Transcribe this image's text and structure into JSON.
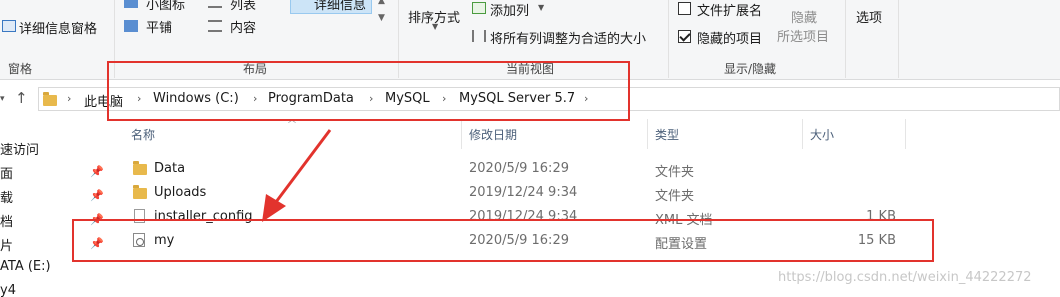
{
  "ribbon": {
    "pane_group": {
      "details_pane": "详细信息窗格",
      "label": "窗格"
    },
    "layout_group": {
      "small_icons": "小图标",
      "list": "列表",
      "details": "详细信息",
      "tiles": "平铺",
      "content": "内容",
      "label": "布局"
    },
    "current_view_group": {
      "sort_by": "排序方式",
      "add_columns": "添加列",
      "size_all_columns": "将所有列调整为合适的大小",
      "label": "当前视图"
    },
    "show_hide_group": {
      "file_extensions": "文件扩展名",
      "file_extensions_checked": false,
      "hidden_items": "隐藏的项目",
      "hidden_items_checked": true,
      "hide_selected_line1": "隐藏",
      "hide_selected_line2": "所选项目",
      "label": "显示/隐藏"
    },
    "options": "选项"
  },
  "address_bar": {
    "breadcrumbs": [
      "此电脑",
      "Windows (C:)",
      "ProgramData",
      "MySQL",
      "MySQL Server 5.7"
    ]
  },
  "columns": {
    "name": "名称",
    "date_modified": "修改日期",
    "type": "类型",
    "size": "大小"
  },
  "nav_pane": {
    "items": [
      "速访问",
      "面",
      "载",
      "档",
      "片",
      "ATA (E:)",
      "y4"
    ]
  },
  "files": [
    {
      "name": "Data",
      "date": "2020/5/9 16:29",
      "type": "文件夹",
      "size": "",
      "icon": "folder-icon"
    },
    {
      "name": "Uploads",
      "date": "2019/12/24 9:34",
      "type": "文件夹",
      "size": "",
      "icon": "folder-icon"
    },
    {
      "name": "installer_config",
      "date": "2019/12/24 9:34",
      "type": "XML 文档",
      "size": "1 KB",
      "icon": "xml-file-icon"
    },
    {
      "name": "my",
      "date": "2020/5/9 16:29",
      "type": "配置设置",
      "size": "15 KB",
      "icon": "config-file-icon"
    }
  ],
  "watermark": "https://blog.csdn.net/weixin_44222272",
  "colors": {
    "annotation_red": "#e2332d",
    "folder_yellow": "#e8b94c",
    "header_text": "#4c607a"
  }
}
